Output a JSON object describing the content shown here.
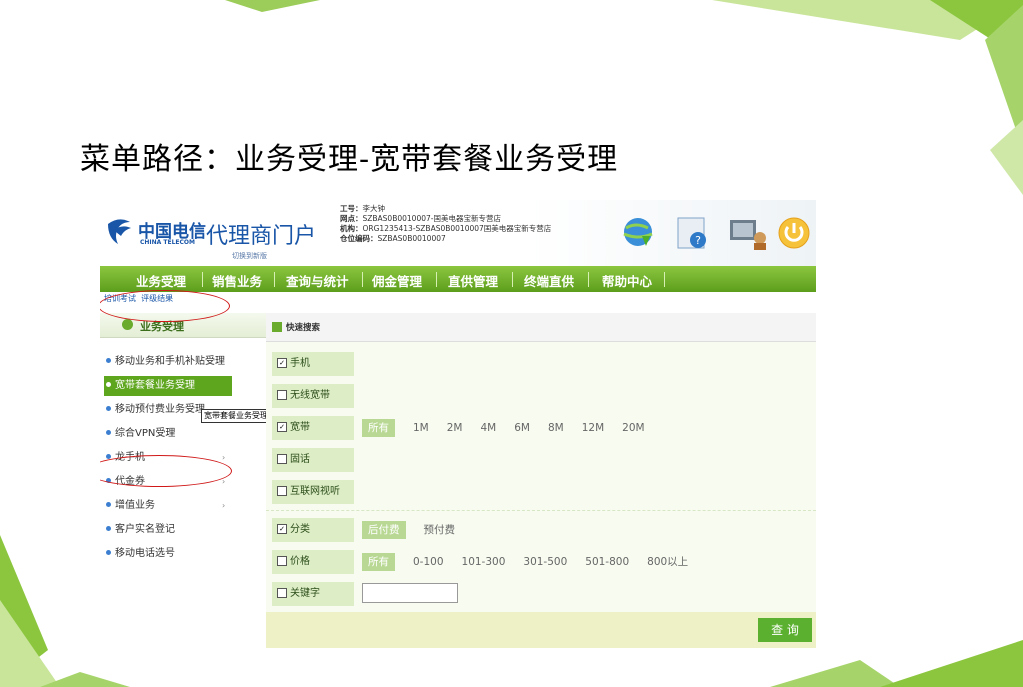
{
  "slide": {
    "title": "菜单路径：业务受理-宽带套餐业务受理"
  },
  "header": {
    "brand_cn": "中国电信",
    "brand_en": "CHINA TELECOM",
    "portal": "代理商门户",
    "switch_link": "切换到新版",
    "info": [
      {
        "key": "工号：",
        "value": "李大钟"
      },
      {
        "key": "网点：",
        "value": "SZBAS0B0010007-国美电器宝新专营店"
      },
      {
        "key": "机构：",
        "value": "ORG1235413-SZBAS0B0010007国美电器宝新专营店"
      },
      {
        "key": "仓位编码：",
        "value": "SZBAS0B0010007"
      }
    ]
  },
  "nav": {
    "items": [
      "业务受理",
      "销售业务",
      "查询与统计",
      "佣金管理",
      "直供管理",
      "终端直供",
      "帮助中心"
    ]
  },
  "sublinks": [
    "培训考试",
    "评级结果"
  ],
  "sidebar": {
    "title": "业务受理",
    "items": [
      {
        "label": "移动业务和手机补贴受理"
      },
      {
        "label": "宽带套餐业务受理"
      },
      {
        "label": "移动预付费业务受理"
      },
      {
        "label": "综合VPN受理"
      },
      {
        "label": "龙手机",
        "arrow": "›"
      },
      {
        "label": "代金券",
        "arrow": "›"
      },
      {
        "label": "增值业务",
        "arrow": "›"
      },
      {
        "label": "客户实名登记"
      },
      {
        "label": "移动电话选号"
      }
    ],
    "tooltip": "宽带套餐业务受理"
  },
  "search": {
    "title": "快速搜索",
    "rows": [
      {
        "label": "手机",
        "checked": true
      },
      {
        "label": "无线宽带",
        "checked": false
      },
      {
        "label": "宽带",
        "checked": true,
        "options": [
          "所有",
          "1M",
          "2M",
          "4M",
          "6M",
          "8M",
          "12M",
          "20M"
        ],
        "selected": "所有"
      },
      {
        "label": "固话",
        "checked": false
      },
      {
        "label": "互联网视听",
        "checked": false
      },
      {
        "label": "分类",
        "checked": true,
        "options": [
          "后付费",
          "预付费"
        ],
        "selected": "后付费"
      },
      {
        "label": "价格",
        "checked": false,
        "options": [
          "所有",
          "0-100",
          "101-300",
          "301-500",
          "501-800",
          "800以上"
        ],
        "selected": "所有"
      },
      {
        "label": "关键字",
        "checked": false,
        "input_value": ""
      }
    ],
    "query_button": "查 询"
  },
  "colors": {
    "nav_green": "#5c9e1c",
    "selected_green": "#5ea61e",
    "brand_blue": "#1a56a8",
    "annotation_red": "#d01818"
  }
}
